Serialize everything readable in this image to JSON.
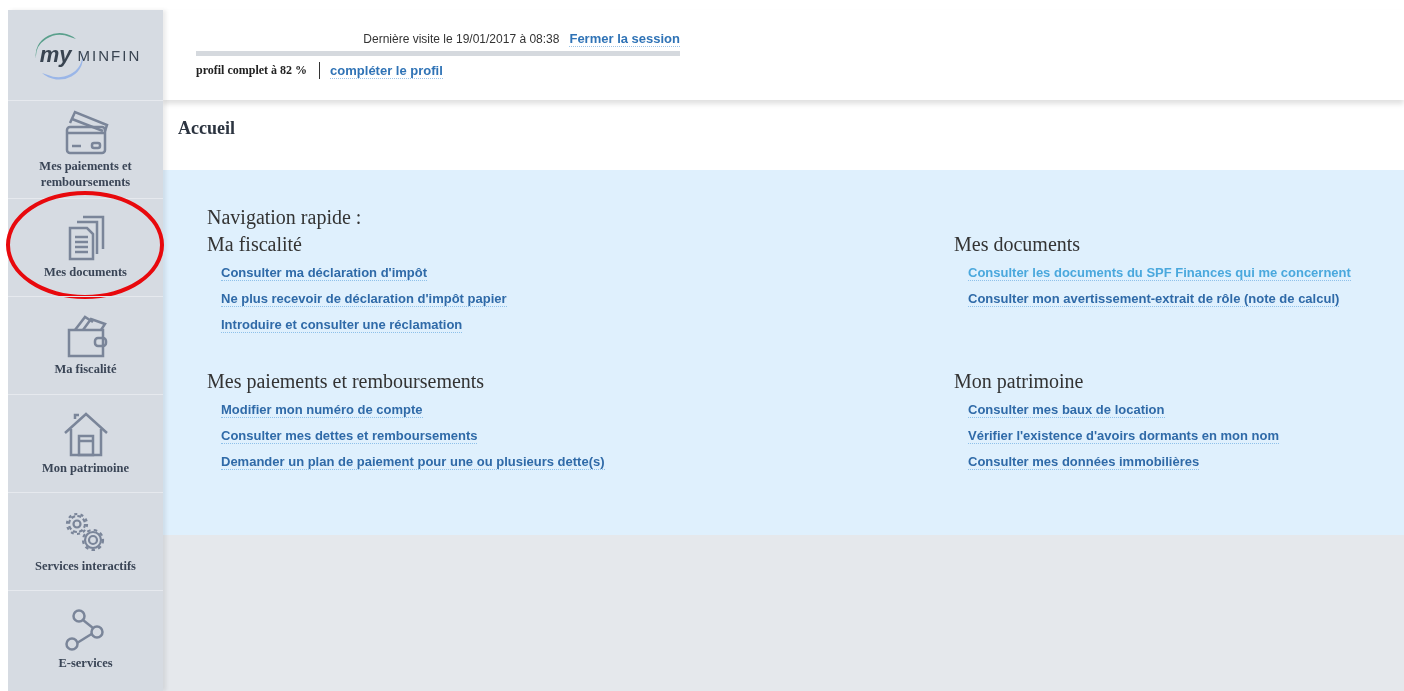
{
  "logo": {
    "prefix": "my",
    "name": "MINFIN"
  },
  "header": {
    "last_visit": "Dernière visite le 19/01/2017 à 08:38",
    "logout": "Fermer la session",
    "profile_status": "profil complet à 82 %",
    "complete_profile": "compléter le profil"
  },
  "sidebar": {
    "items": [
      {
        "kind": "card",
        "label": "Mes paiements et remboursements",
        "circled": false
      },
      {
        "kind": "documents",
        "label": "Mes documents",
        "circled": true
      },
      {
        "kind": "wallet",
        "label": "Ma fiscalité",
        "circled": false
      },
      {
        "kind": "house",
        "label": "Mon patrimoine",
        "circled": false
      },
      {
        "kind": "gears",
        "label": "Services interactifs",
        "circled": false
      },
      {
        "kind": "network",
        "label": "E-services",
        "circled": false
      }
    ]
  },
  "page_title": "Accueil",
  "quick_nav": {
    "title": "Navigation rapide :",
    "columns": [
      {
        "sections": [
          {
            "title": "Ma fiscalité",
            "links": [
              {
                "label": "Consulter ma déclaration d'impôt",
                "hovered": false
              },
              {
                "label": "Ne plus recevoir de déclaration d'impôt papier",
                "hovered": false
              },
              {
                "label": "Introduire et consulter une réclamation",
                "hovered": false
              }
            ]
          },
          {
            "title": "Mes paiements et remboursements",
            "links": [
              {
                "label": "Modifier mon numéro de compte",
                "hovered": false
              },
              {
                "label": "Consulter mes dettes et remboursements",
                "hovered": false
              },
              {
                "label": "Demander un plan de paiement pour une ou plusieurs dette(s)",
                "hovered": false
              }
            ]
          }
        ]
      },
      {
        "sections": [
          {
            "title": "Mes documents",
            "links": [
              {
                "label": "Consulter les documents du SPF Finances qui me concernent",
                "hovered": true
              },
              {
                "label": "Consulter mon avertissement-extrait de rôle (note de calcul)",
                "hovered": false
              }
            ]
          },
          {
            "title": "Mon patrimoine",
            "links": [
              {
                "label": "Consulter mes baux de location",
                "hovered": false
              },
              {
                "label": "Vérifier l'existence d'avoirs dormants en mon nom",
                "hovered": false
              },
              {
                "label": "Consulter mes données immobilières",
                "hovered": false
              }
            ]
          }
        ]
      }
    ]
  }
}
